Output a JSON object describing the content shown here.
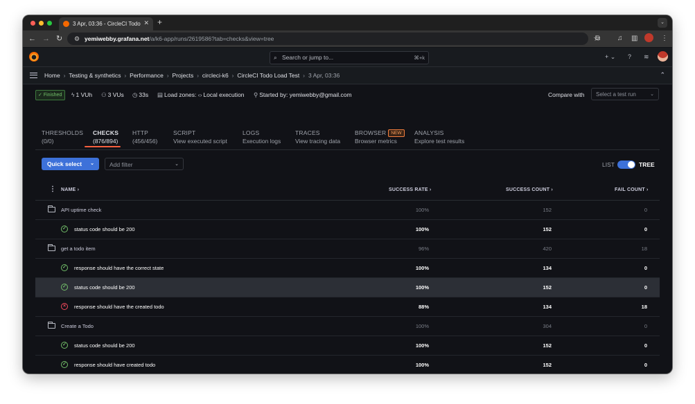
{
  "browser": {
    "tab_title": "3 Apr, 03:36 - CircleCI Todo L",
    "url_host": "yemiwebby.grafana.net",
    "url_path": "/a/k6-app/runs/2619586?tab=checks&view=tree"
  },
  "header": {
    "search_placeholder": "Search or jump to...",
    "search_shortcut": "⌘+k",
    "plus_label": "+ ⌄"
  },
  "breadcrumb": {
    "items": [
      "Home",
      "Testing & synthetics",
      "Performance",
      "Projects",
      "circleci-k6",
      "CircleCI Todo Load Test"
    ],
    "current": "3 Apr, 03:36"
  },
  "run": {
    "status": "Finished",
    "vuh": "1 VUh",
    "vus": "3 VUs",
    "duration": "33s",
    "load_zones_label": "Load zones:",
    "load_zones_value": "Local execution",
    "started_by_label": "Started by:",
    "started_by_value": "yemiwebby@gmail.com",
    "compare_label": "Compare with",
    "compare_placeholder": "Select a test run"
  },
  "tabs": [
    {
      "label": "THRESHOLDS",
      "sub": "(0/0)"
    },
    {
      "label": "CHECKS",
      "sub": "(876/894)"
    },
    {
      "label": "HTTP",
      "sub": "(456/456)"
    },
    {
      "label": "SCRIPT",
      "sub": "View executed script"
    },
    {
      "label": "LOGS",
      "sub": "Execution logs"
    },
    {
      "label": "TRACES",
      "sub": "View tracing data"
    },
    {
      "label": "BROWSER",
      "sub": "Browser metrics",
      "badge": "NEW"
    },
    {
      "label": "ANALYSIS",
      "sub": "Explore test results"
    }
  ],
  "filters": {
    "quick_select": "Quick select",
    "add_filter": "Add filter",
    "view_list": "LIST",
    "view_tree": "TREE",
    "tree_on": true
  },
  "table": {
    "columns": {
      "name": "NAME",
      "success_rate": "SUCCESS RATE",
      "success_count": "SUCCESS COUNT",
      "fail_count": "FAIL COUNT"
    },
    "rows": [
      {
        "type": "group",
        "name": "API uptime check",
        "rate": "100%",
        "success": "152",
        "fail": "0"
      },
      {
        "type": "check",
        "status": "ok",
        "name": "status code should be 200",
        "rate": "100%",
        "success": "152",
        "fail": "0"
      },
      {
        "type": "group",
        "name": "get a todo item",
        "rate": "96%",
        "success": "420",
        "fail": "18"
      },
      {
        "type": "check",
        "status": "ok",
        "name": "response should have the correct state",
        "rate": "100%",
        "success": "134",
        "fail": "0"
      },
      {
        "type": "check",
        "status": "ok",
        "name": "status code should be 200",
        "rate": "100%",
        "success": "152",
        "fail": "0",
        "selected": true
      },
      {
        "type": "check",
        "status": "fail",
        "name": "response should have the created todo",
        "rate": "88%",
        "success": "134",
        "fail": "18"
      },
      {
        "type": "group",
        "name": "Create a Todo",
        "rate": "100%",
        "success": "304",
        "fail": "0"
      },
      {
        "type": "check",
        "status": "ok",
        "name": "status code should be 200",
        "rate": "100%",
        "success": "152",
        "fail": "0"
      },
      {
        "type": "check",
        "status": "ok",
        "name": "response should have created todo",
        "rate": "100%",
        "success": "152",
        "fail": "0"
      }
    ]
  }
}
